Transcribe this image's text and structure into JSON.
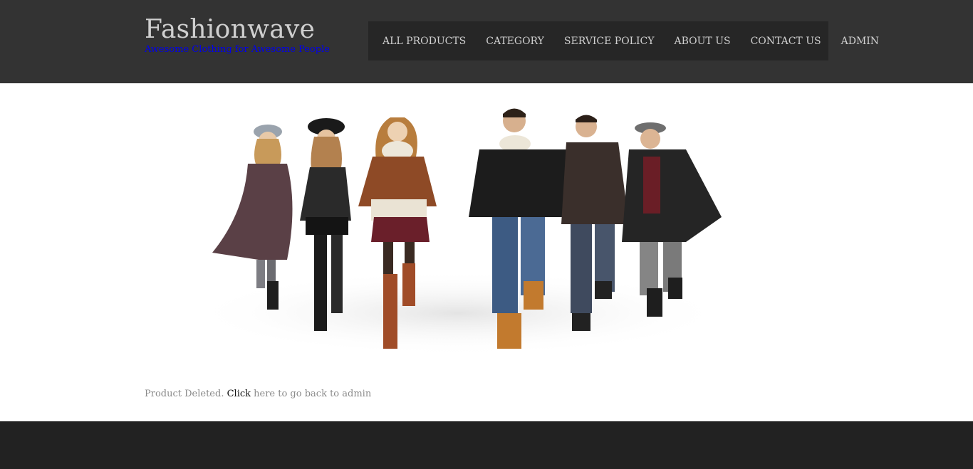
{
  "header": {
    "site_title": "Fashionwave",
    "tagline": "Awesome Clothing for Awesome People",
    "tagline_color": "#0000ee",
    "background_color": "#333333"
  },
  "nav": {
    "items": [
      {
        "label": "ALL PRODUCTS"
      },
      {
        "label": "CATEGORY"
      },
      {
        "label": "SERVICE POLICY"
      },
      {
        "label": "ABOUT US"
      },
      {
        "label": "CONTACT US"
      },
      {
        "label": "ADMIN"
      }
    ]
  },
  "banner": {
    "image_subject": "fashion-models-banner"
  },
  "message": {
    "prefix": "Product Deleted. ",
    "link_text": "Click",
    "suffix": " here to go back to admin"
  },
  "footer": {
    "background_color": "#222222"
  }
}
